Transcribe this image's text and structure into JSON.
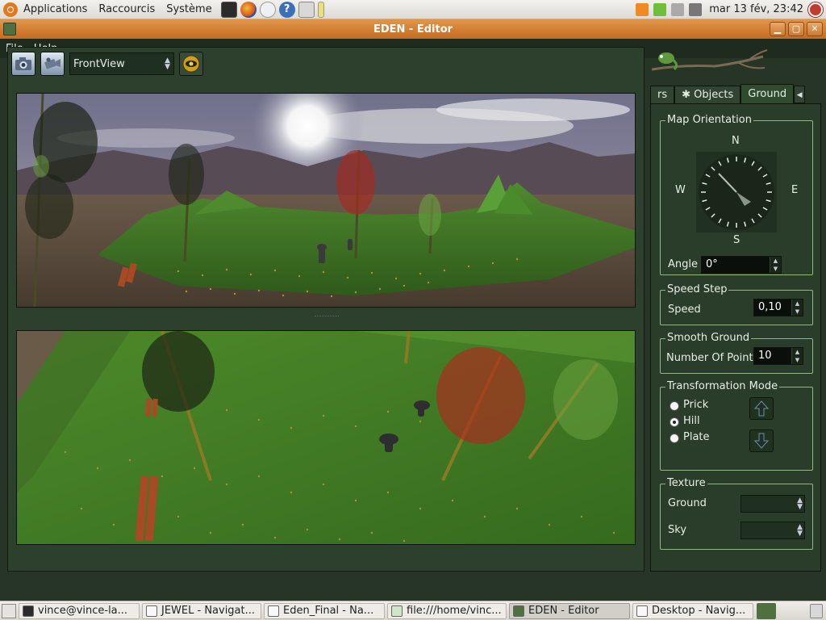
{
  "top_panel": {
    "menus": [
      "Applications",
      "Raccourcis",
      "Système"
    ],
    "clock": "mar 13 fév, 23:42"
  },
  "window": {
    "title": "EDEN - Editor",
    "menus": [
      "File",
      "Help"
    ]
  },
  "toolbar": {
    "view_value": "FrontView"
  },
  "side_panel": {
    "tabs": [
      "rs",
      "Objects",
      "Ground"
    ],
    "map_orientation": {
      "title": "Map Orientation",
      "north": "N",
      "south": "S",
      "east": "E",
      "west": "W",
      "angle_label": "Angle",
      "angle_value": "0°"
    },
    "speed_step": {
      "title": "Speed Step",
      "speed_label": "Speed",
      "speed_value": "0,10"
    },
    "smooth_ground": {
      "title": "Smooth Ground",
      "points_label": "Number Of Point",
      "points_value": "10"
    },
    "transformation_mode": {
      "title": "Transformation Mode",
      "options": [
        "Prick",
        "Hill",
        "Plate"
      ],
      "selected": "Hill"
    },
    "texture": {
      "title": "Texture",
      "ground_label": "Ground",
      "sky_label": "Sky"
    }
  },
  "taskbar": {
    "tasks": [
      "vince@vince-la...",
      "JEWEL - Navigat...",
      "Eden_Final - Na...",
      "file:///home/vinc...",
      "EDEN - Editor",
      "Desktop - Navig..."
    ],
    "active": "EDEN - Editor"
  },
  "colors": {
    "titlebar": "#d47f33",
    "panel_bg": "#2a3c2a",
    "group_border": "#8fb884",
    "grass": "#3f7a25"
  }
}
